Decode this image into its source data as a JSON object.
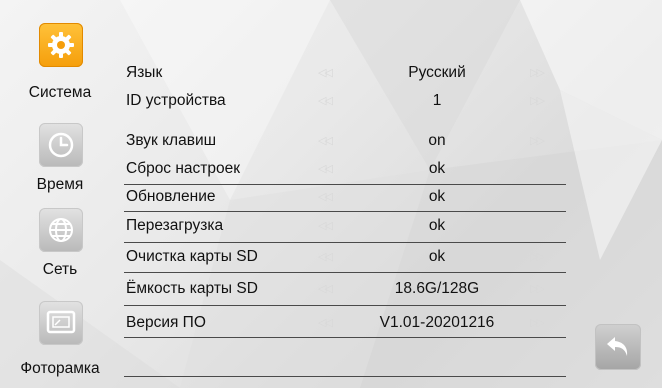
{
  "sidebar": {
    "items": [
      {
        "label": "Система",
        "icon": "gear-icon",
        "active": true
      },
      {
        "label": "Время",
        "icon": "clock-icon",
        "active": false
      },
      {
        "label": "Сеть",
        "icon": "globe-icon",
        "active": false
      },
      {
        "label": "Фоторамка",
        "icon": "photo-frame-icon",
        "active": false
      }
    ]
  },
  "settings": {
    "prev_glyph": "◁◁",
    "next_glyph": "▷▷",
    "rows": [
      {
        "label": "Язык",
        "value": "Русский"
      },
      {
        "label": "ID устройства",
        "value": "1"
      },
      {
        "label": "Звук клавиш",
        "value": "on"
      },
      {
        "label": "Сброс настроек",
        "value": "ok"
      },
      {
        "label": "Обновление",
        "value": "ok"
      },
      {
        "label": "Перезагрузка",
        "value": "ok"
      },
      {
        "label": "Очистка карты SD",
        "value": "ok"
      },
      {
        "label": "Ёмкость карты SD",
        "value": "18.6G/128G"
      },
      {
        "label": "Версия ПО",
        "value": "V1.01-20201216"
      }
    ]
  },
  "back_button": {
    "icon": "back-arrow-icon"
  },
  "colors": {
    "accent": "#f5a623",
    "divider": "#4a4a4a",
    "arrow": "#d8d8d8"
  }
}
